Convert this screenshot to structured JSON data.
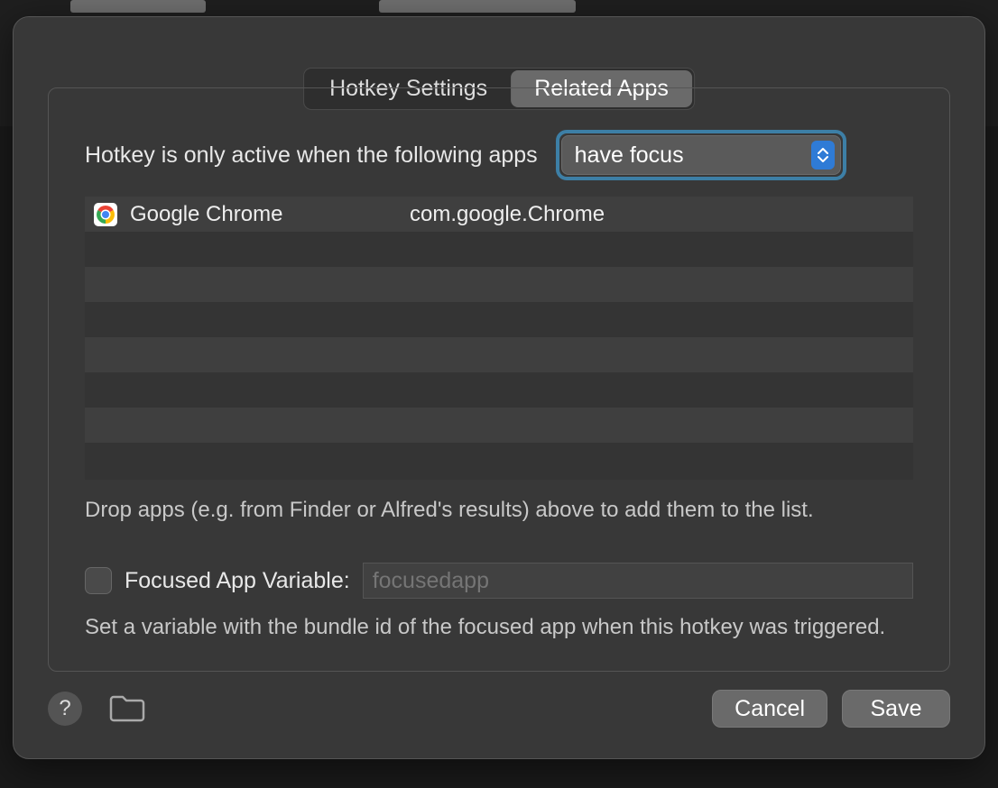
{
  "tabs": {
    "hotkey": "Hotkey Settings",
    "related": "Related Apps",
    "active": "related"
  },
  "description": "Hotkey is only active when the following apps",
  "focus_popup": {
    "selected": "have focus"
  },
  "apps": [
    {
      "name": "Google Chrome",
      "bundle": "com.google.Chrome",
      "icon": "chrome-icon"
    }
  ],
  "table_visible_rows": 8,
  "drop_hint": "Drop apps (e.g. from Finder or Alfred's results) above to add them to the list.",
  "focused_var": {
    "checkbox_checked": false,
    "label": "Focused App Variable:",
    "placeholder": "focusedapp",
    "value": "",
    "hint": "Set a variable with the bundle id of the focused app when this hotkey was triggered."
  },
  "footer": {
    "help_label": "?",
    "cancel": "Cancel",
    "save": "Save"
  }
}
